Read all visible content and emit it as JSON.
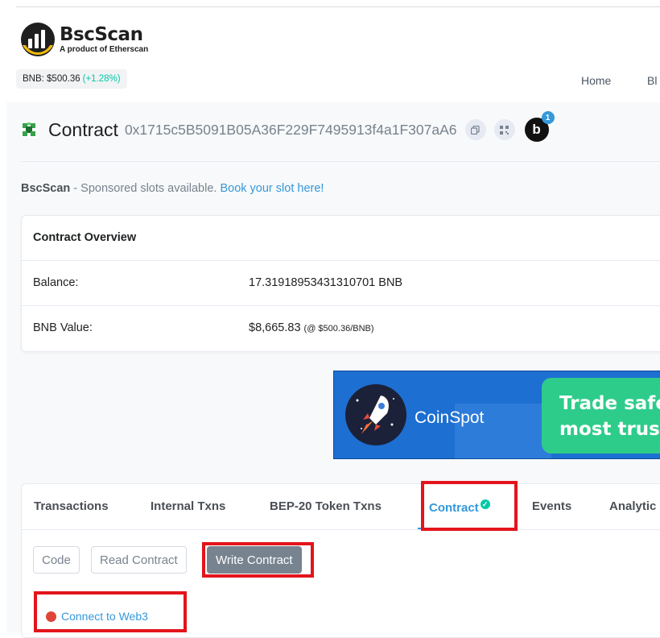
{
  "header": {
    "logo_title": "BscScan",
    "logo_subtitle": "A product of Etherscan",
    "price_label": "BNB: $500.36",
    "price_change": "(+1.28%)",
    "nav": {
      "home": "Home",
      "next_partial": "Bl"
    }
  },
  "contract": {
    "title": "Contract",
    "address": "0x1715c5B5091B05A36F229F7495913f4a1F307aA6",
    "badge_letter": "b",
    "badge_count": "1"
  },
  "sponsor": {
    "brand": "BscScan",
    "text": "- Sponsored slots available.",
    "link": "Book your slot here!"
  },
  "overview": {
    "title": "Contract Overview",
    "rows": [
      {
        "label": "Balance:",
        "value": "17.31918953431310701 BNB",
        "note": ""
      },
      {
        "label": "BNB Value:",
        "value": "$8,665.83",
        "note": "(@ $500.36/BNB)"
      }
    ]
  },
  "banner": {
    "brand": "CoinSpot",
    "cta_line1": "Trade safe",
    "cta_line2": "most trust"
  },
  "tabs": {
    "items": [
      {
        "label": "Transactions"
      },
      {
        "label": "Internal Txns"
      },
      {
        "label": "BEP-20 Token Txns"
      },
      {
        "label": "Contract"
      },
      {
        "label": "Events"
      },
      {
        "label": "Analytic"
      }
    ],
    "active": "Contract"
  },
  "contract_tabs": {
    "code": "Code",
    "read": "Read Contract",
    "write": "Write Contract",
    "active": "Write Contract"
  },
  "web3": {
    "connect_label": "Connect to Web3"
  },
  "colors": {
    "accent": "#3498db",
    "success": "#00c9a7",
    "highlight": "#e3141b",
    "disconnected_dot": "#de4437"
  }
}
